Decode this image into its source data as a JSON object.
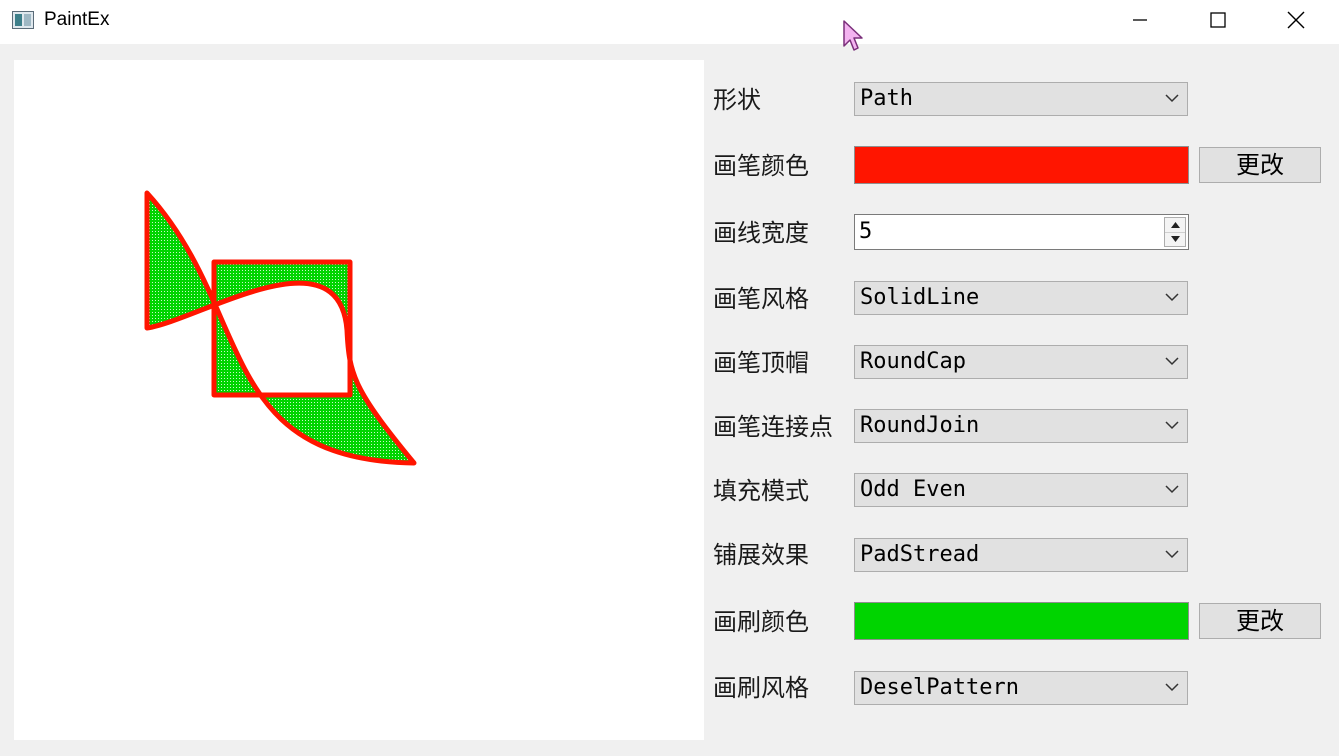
{
  "window": {
    "title": "PaintEx"
  },
  "form": {
    "shape": {
      "label": "形状",
      "value": "Path"
    },
    "pen_color": {
      "label": "画笔颜色",
      "color": "#ff1500",
      "change_label": "更改"
    },
    "pen_width": {
      "label": "画线宽度",
      "value": "5"
    },
    "pen_style": {
      "label": "画笔风格",
      "value": "SolidLine"
    },
    "pen_cap": {
      "label": "画笔顶帽",
      "value": "RoundCap"
    },
    "pen_join": {
      "label": "画笔连接点",
      "value": "RoundJoin"
    },
    "fill_mode": {
      "label": "填充模式",
      "value": "Odd Even"
    },
    "spread": {
      "label": "铺展效果",
      "value": "PadStread"
    },
    "brush_color": {
      "label": "画刷颜色",
      "color": "#00d400",
      "change_label": "更改"
    },
    "brush_style": {
      "label": "画刷风格",
      "value": "DeselPattern"
    }
  },
  "colors": {
    "pen": "#ff1500",
    "brush": "#00d400"
  },
  "icons": [
    "app-icon",
    "minimize-icon",
    "maximize-icon",
    "close-icon",
    "chevron-down-icon",
    "spin-up-icon",
    "spin-down-icon",
    "mouse-cursor-icon"
  ]
}
